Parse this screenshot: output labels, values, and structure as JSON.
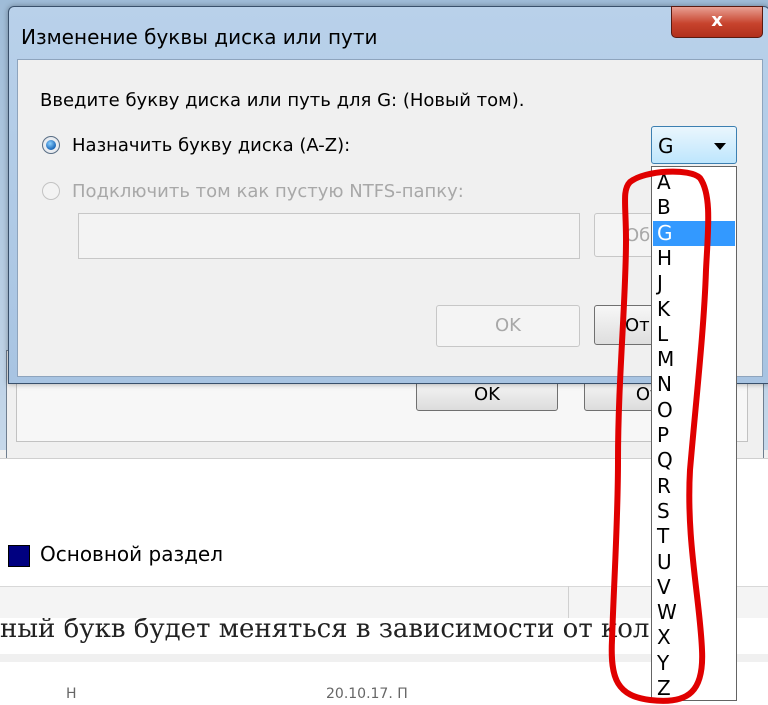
{
  "dialog": {
    "title": "Изменение буквы диска или пути",
    "close_label": "x",
    "prompt": "Введите букву диска или путь для G: (Новый том).",
    "option_assign_label": "Назначить букву диска (A-Z):",
    "option_mount_label": "Подключить том как пустую NTFS-папку:",
    "path_value": "",
    "browse_label": "Об",
    "ok_label": "OK",
    "cancel_label": "От",
    "selected_letter": "G",
    "letters": [
      "A",
      "B",
      "G",
      "H",
      "J",
      "K",
      "L",
      "M",
      "N",
      "O",
      "P",
      "Q",
      "R",
      "S",
      "T",
      "U",
      "V",
      "W",
      "X",
      "Y",
      "Z"
    ],
    "selected_index": 2
  },
  "background": {
    "ok_label": "OK",
    "cancel_label": "Отм",
    "legend_label": "Основной раздел",
    "page_text": "ный букв будет меняться в зависимости от кол",
    "bottom_text_1": "Н",
    "bottom_text_2": "20.10.17. П"
  },
  "colors": {
    "legend_swatch": "#000080",
    "selection": "#3399ff",
    "annotation": "#e00000",
    "titlebar": "#b9d1ea"
  }
}
